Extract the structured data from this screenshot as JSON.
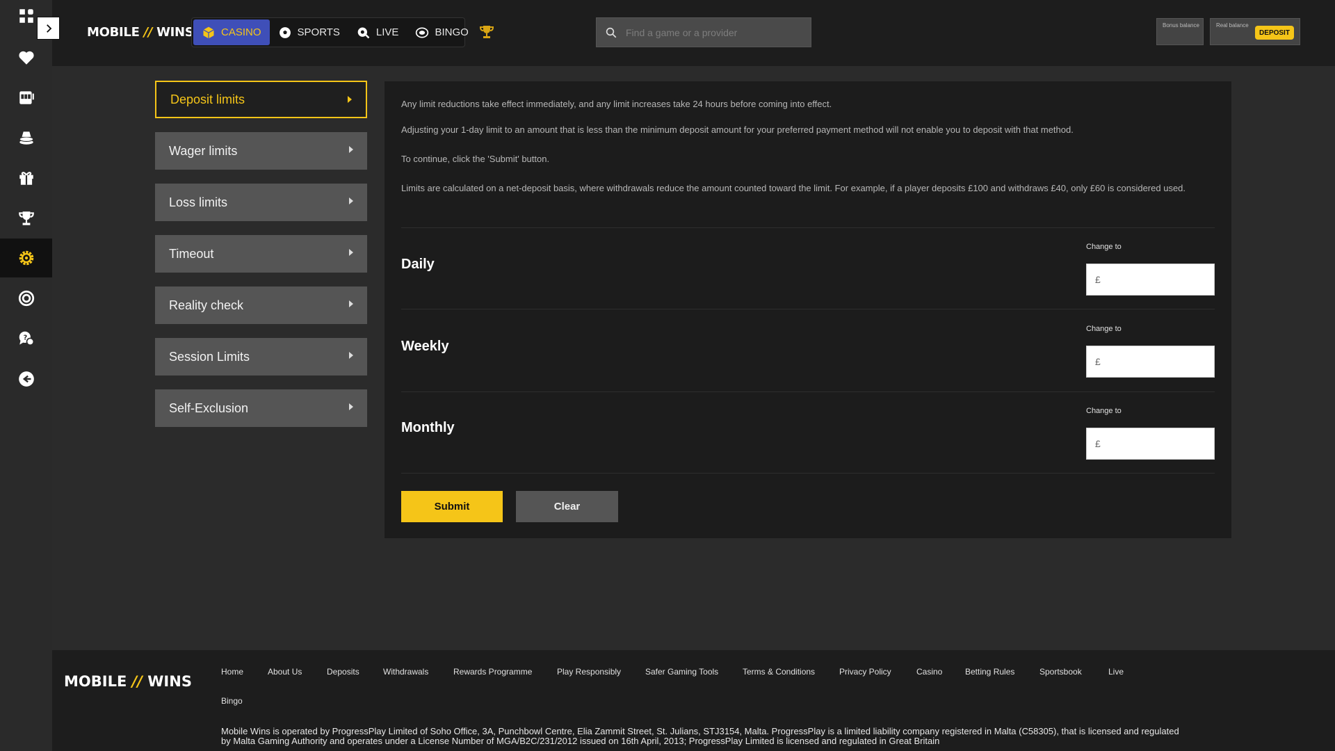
{
  "header": {
    "logo_main": "MOBILE",
    "logo_slash": "//",
    "logo_end": "WINS",
    "tabs": [
      {
        "label": "CASINO",
        "icon": "casino-icon",
        "active": true
      },
      {
        "label": "SPORTS",
        "icon": "soccer-ball-icon",
        "active": false
      },
      {
        "label": "LIVE",
        "icon": "live-chip-icon",
        "active": false
      },
      {
        "label": "BINGO",
        "icon": "bingo-ball-icon",
        "active": false
      }
    ],
    "search_placeholder": "Find a game or a provider",
    "bonus_balance_label": "Bonus balance",
    "real_balance_label": "Real balance",
    "deposit_label": "DEPOSIT"
  },
  "rail": {
    "icons": [
      "apps-icon",
      "heart-icon",
      "slot-machine-icon",
      "poker-chips-icon",
      "gift-icon",
      "trophy-icon",
      "settings-icon",
      "lifebuoy-icon",
      "support-chat-icon",
      "logout-icon"
    ],
    "active_index": 6
  },
  "menu": {
    "items": [
      "Deposit limits",
      "Wager limits",
      "Loss limits",
      "Timeout",
      "Reality check",
      "Session Limits",
      "Self-Exclusion"
    ],
    "active_index": 0
  },
  "panel": {
    "info1": "Any limit reductions take effect immediately, and any limit increases take 24 hours before coming into effect.",
    "info2": "Adjusting your 1-day limit to an amount that is less than the minimum deposit amount for your preferred payment method will not enable you to deposit with that method.",
    "info3": "To continue, click the 'Submit' button.",
    "info4": "Limits are calculated on a net-deposit basis, where withdrawals reduce the amount counted toward the limit. For example, if a player deposits £100 and withdraws £40, only £60 is considered used.",
    "change_label": "Change to",
    "currency": "£",
    "periods": {
      "daily": "Daily",
      "weekly": "Weekly",
      "monthly": "Monthly"
    },
    "submit": "Submit",
    "clear": "Clear"
  },
  "footer": {
    "logo_main": "MOBILE",
    "logo_slash": "//",
    "logo_end": "WINS",
    "links": [
      "Home",
      "About Us",
      "Deposits",
      "Withdrawals",
      "Rewards Programme",
      "Play Responsibly",
      "Safer Gaming Tools",
      "Terms & Conditions",
      "Privacy Policy",
      "Casino",
      "Betting Rules",
      "Sportsbook",
      "Live",
      "Bingo"
    ],
    "legal": "Mobile Wins is operated by ProgressPlay Limited of Soho Office, 3A, Punchbowl Centre, Elia Zammit Street, St. Julians, STJ3154, Malta. ProgressPlay is a limited liability company registered in Malta (C58305), that is licensed and regulated by Malta Gaming Authority and operates under a License Number of MGA/B2C/231/2012 issued on 16th April, 2013; ProgressPlay Limited is licensed and regulated in Great Britain"
  },
  "colors": {
    "accent": "#f5c518",
    "active_tab": "#3f4fb8",
    "panel": "#1c1c1c",
    "menu_item": "#555555"
  }
}
